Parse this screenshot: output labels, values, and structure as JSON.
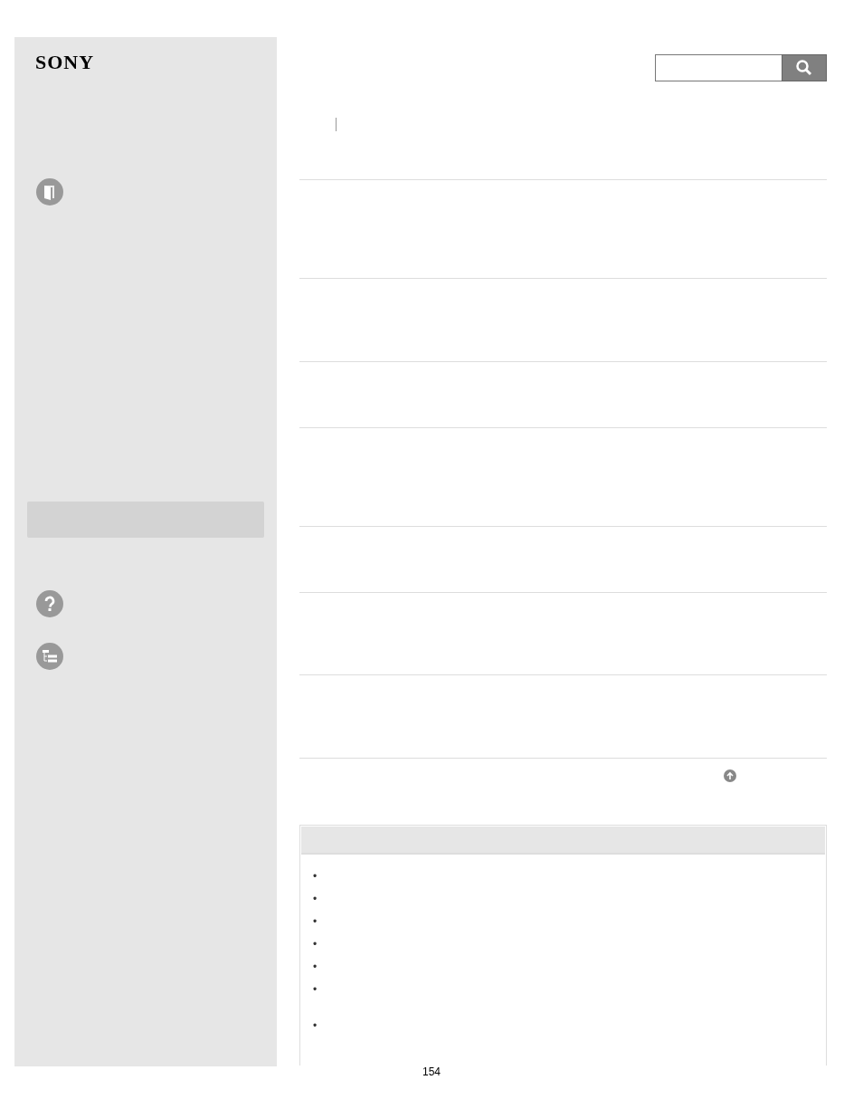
{
  "logo": "SONY",
  "notes": [
    {
      "bullet": "•"
    },
    {
      "bullet": "•"
    },
    {
      "bullet": "•"
    },
    {
      "bullet": "•"
    },
    {
      "bullet": "•"
    },
    {
      "bullet": "•"
    },
    {
      "bullet": "•"
    }
  ],
  "page_number": "154"
}
